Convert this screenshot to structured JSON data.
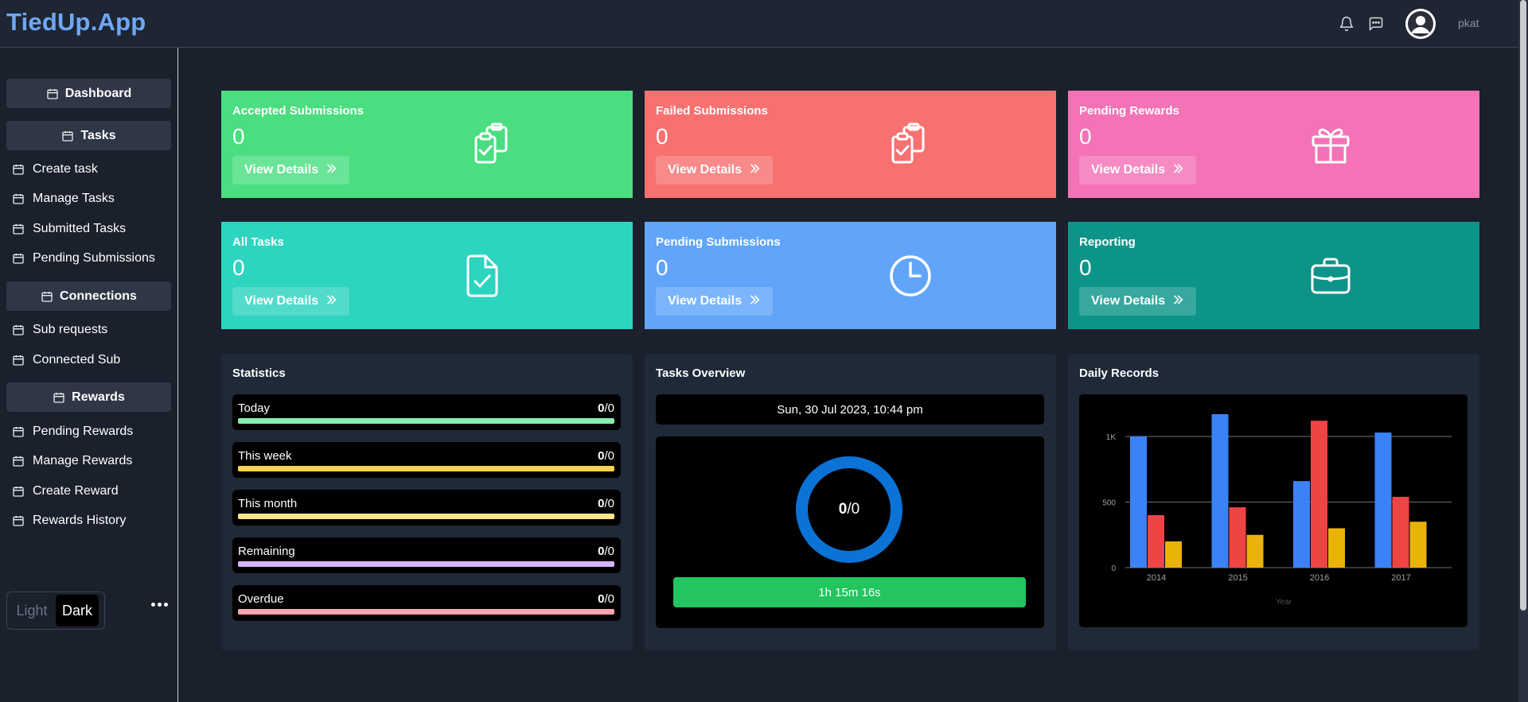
{
  "header": {
    "brand": "TiedUp.App",
    "username": "pkat"
  },
  "sidebar": {
    "headers": [
      {
        "label": "Dashboard"
      },
      {
        "label": "Tasks"
      },
      {
        "label": "Connections"
      },
      {
        "label": "Rewards"
      }
    ],
    "items": [
      {
        "label": "Create task"
      },
      {
        "label": "Manage Tasks"
      },
      {
        "label": "Submitted Tasks"
      },
      {
        "label": "Pending Submissions"
      },
      {
        "label": "Sub requests"
      },
      {
        "label": "Connected Sub"
      },
      {
        "label": "Pending Rewards"
      },
      {
        "label": "Manage Rewards"
      },
      {
        "label": "Create Reward"
      },
      {
        "label": "Rewards History"
      }
    ],
    "theme": {
      "light": "Light",
      "dark": "Dark",
      "selected": "Dark"
    }
  },
  "cards": [
    {
      "title": "Accepted Submissions",
      "value": "0",
      "button": "View Details",
      "color": "#4ade80",
      "icon": "clipboard-check-icon"
    },
    {
      "title": "Failed Submissions",
      "value": "0",
      "button": "View Details",
      "color": "#f87171",
      "icon": "clipboard-check-icon"
    },
    {
      "title": "Pending Rewards",
      "value": "0",
      "button": "View Details",
      "color": "#f472b6",
      "icon": "gift-icon"
    },
    {
      "title": "All Tasks",
      "value": "0",
      "button": "View Details",
      "color": "#2dd4bf",
      "icon": "file-check-icon"
    },
    {
      "title": "Pending Submissions",
      "value": "0",
      "button": "View Details",
      "color": "#60a5fa",
      "icon": "clock-icon"
    },
    {
      "title": "Reporting",
      "value": "0",
      "button": "View Details",
      "color": "#0d9488",
      "icon": "briefcase-icon"
    }
  ],
  "statistics": {
    "title": "Statistics",
    "rows": [
      {
        "label": "Today",
        "done": "0",
        "total": "/0",
        "color": "#86efac"
      },
      {
        "label": "This week",
        "done": "0",
        "total": "/0",
        "color": "#fcd34d"
      },
      {
        "label": "This month",
        "done": "0",
        "total": "/0",
        "color": "#fde68a"
      },
      {
        "label": "Remaining",
        "done": "0",
        "total": "/0",
        "color": "#d8b4fe"
      },
      {
        "label": "Overdue",
        "done": "0",
        "total": "/0",
        "color": "#fda4af"
      }
    ]
  },
  "overview": {
    "title": "Tasks Overview",
    "datetime": "Sun, 30 Jul 2023, 10:44 pm",
    "done": "0",
    "total": "/0",
    "timer": "1h 15m 16s"
  },
  "daily": {
    "title": "Daily Records"
  },
  "chart_data": {
    "type": "bar",
    "categories": [
      "2014",
      "2015",
      "2016",
      "2017"
    ],
    "series": [
      {
        "values": [
          1000,
          1170,
          660,
          1030
        ],
        "color": "#3b82f6"
      },
      {
        "values": [
          400,
          460,
          1120,
          540
        ],
        "color": "#ef4444"
      },
      {
        "values": [
          200,
          250,
          300,
          350
        ],
        "color": "#eab308"
      }
    ],
    "xlabel": "Year",
    "ylabel": "",
    "ylim": [
      0,
      1200
    ],
    "yticks": [
      "0",
      "500",
      "1K"
    ],
    "ytick_values": [
      0,
      500,
      1000
    ],
    "grid": true
  }
}
